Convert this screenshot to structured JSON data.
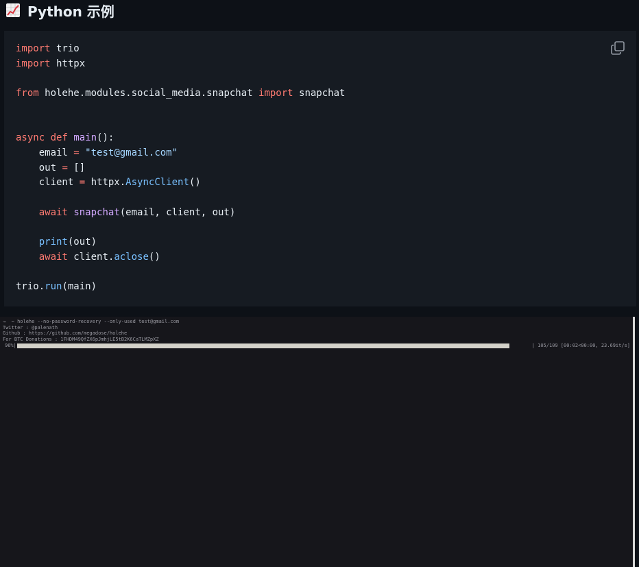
{
  "heading": {
    "icon": "chart-increasing-icon",
    "title": "Python 示例"
  },
  "code_block": {
    "copy_icon": "copy-icon",
    "lines": [
      [
        {
          "t": "kw",
          "v": "import"
        },
        {
          "t": "",
          "v": " trio"
        }
      ],
      [
        {
          "t": "kw",
          "v": "import"
        },
        {
          "t": "",
          "v": " httpx"
        }
      ],
      [],
      [
        {
          "t": "kw",
          "v": "from"
        },
        {
          "t": "",
          "v": " holehe.modules.social_media.snapchat "
        },
        {
          "t": "kw",
          "v": "import"
        },
        {
          "t": "",
          "v": " snapchat"
        }
      ],
      [],
      [],
      [
        {
          "t": "kw",
          "v": "async"
        },
        {
          "t": "",
          "v": " "
        },
        {
          "t": "kw",
          "v": "def"
        },
        {
          "t": "",
          "v": " "
        },
        {
          "t": "fn",
          "v": "main"
        },
        {
          "t": "",
          "v": "():"
        }
      ],
      [
        {
          "t": "",
          "v": "    email "
        },
        {
          "t": "kw",
          "v": "="
        },
        {
          "t": "",
          "v": " "
        },
        {
          "t": "str",
          "v": "\"test@gmail.com\""
        }
      ],
      [
        {
          "t": "",
          "v": "    out "
        },
        {
          "t": "kw",
          "v": "="
        },
        {
          "t": "",
          "v": " []"
        }
      ],
      [
        {
          "t": "",
          "v": "    client "
        },
        {
          "t": "kw",
          "v": "="
        },
        {
          "t": "",
          "v": " httpx."
        },
        {
          "t": "attr",
          "v": "AsyncClient"
        },
        {
          "t": "",
          "v": "()"
        }
      ],
      [],
      [
        {
          "t": "",
          "v": "    "
        },
        {
          "t": "kw",
          "v": "await"
        },
        {
          "t": "",
          "v": " "
        },
        {
          "t": "fn",
          "v": "snapchat"
        },
        {
          "t": "",
          "v": "(email, client, out)"
        }
      ],
      [],
      [
        {
          "t": "",
          "v": "    "
        },
        {
          "t": "attr",
          "v": "print"
        },
        {
          "t": "",
          "v": "(out)"
        }
      ],
      [
        {
          "t": "",
          "v": "    "
        },
        {
          "t": "kw",
          "v": "await"
        },
        {
          "t": "",
          "v": " client."
        },
        {
          "t": "attr",
          "v": "aclose"
        },
        {
          "t": "",
          "v": "()"
        }
      ],
      [],
      [
        {
          "t": "",
          "v": "trio."
        },
        {
          "t": "attr",
          "v": "run"
        },
        {
          "t": "",
          "v": "(main)"
        }
      ]
    ]
  },
  "terminal": {
    "lines": [
      "→  ~ holehe --no-password-recovery --only-used test@gmail.com",
      "Twitter : @palenath",
      "Github : https://github.com/megadose/holehe",
      "For BTC Donations : 1FHDM49QfZX6pJmhjLE5tB2K6CaTLMZpXZ"
    ],
    "progress_percent_label": "96%|",
    "progress_fraction": 0.96,
    "progress_stats": "| 105/109 [00:02<00:00, 23.69it/s]"
  },
  "colors": {
    "keyword": "#ff7b72",
    "string": "#a5d6ff",
    "function": "#d2a8ff",
    "attribute": "#79c0ff",
    "plain": "#e6edf3",
    "code_background": "#161b22",
    "page_background": "#0d1117",
    "terminal_background": "#16161b",
    "progress_fill": "#d4d2ca"
  }
}
